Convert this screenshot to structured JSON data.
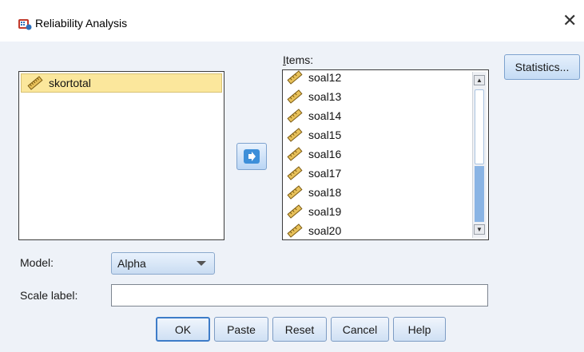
{
  "window": {
    "title": "Reliability Analysis"
  },
  "source_list": {
    "items": [
      "skortotal"
    ]
  },
  "items_panel": {
    "label": "Items:",
    "items": [
      "soal12",
      "soal13",
      "soal14",
      "soal15",
      "soal16",
      "soal17",
      "soal18",
      "soal19",
      "soal20"
    ]
  },
  "buttons": {
    "statistics": "Statistics...",
    "ok": "OK",
    "paste": "Paste",
    "reset": "Reset",
    "cancel": "Cancel",
    "help": "Help"
  },
  "model": {
    "label": "Model:",
    "value": "Alpha"
  },
  "scale": {
    "label": "Scale label:",
    "value": ""
  },
  "icons": {
    "app": "spss-reliability-icon",
    "variable": "ruler-scale-icon",
    "move": "arrow-right-icon",
    "close": "close-icon"
  },
  "colors": {
    "selected_item_bg": "#fbe79c",
    "panel_bg": "#eef2f8",
    "accent_blue": "#3d8fd9"
  }
}
